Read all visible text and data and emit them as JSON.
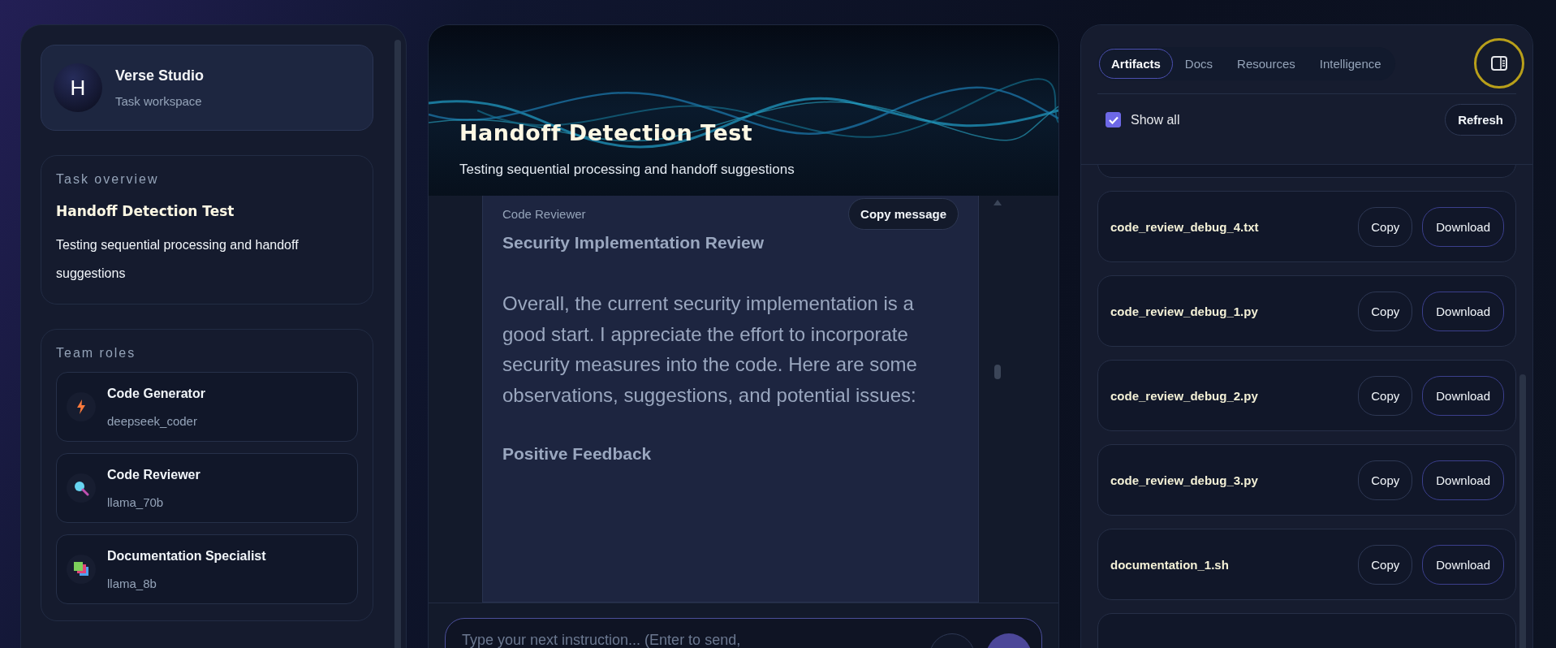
{
  "sidebar": {
    "brand": {
      "initial": "H",
      "name": "Verse Studio",
      "subtitle": "Task workspace"
    },
    "task_overview": {
      "heading": "Task overview",
      "title": "Handoff Detection Test",
      "description": "Testing sequential processing and handoff suggestions"
    },
    "team_roles": {
      "heading": "Team roles",
      "roles": [
        {
          "name": "Code Generator",
          "model": "deepseek_coder",
          "kind": "bolt"
        },
        {
          "name": "Code Reviewer",
          "model": "llama_70b",
          "kind": "search"
        },
        {
          "name": "Documentation Specialist",
          "model": "llama_8b",
          "kind": "stack"
        }
      ]
    }
  },
  "chat": {
    "title": "Handoff Detection Test",
    "subtitle": "Testing sequential processing and handoff suggestions",
    "message": {
      "author": "Code Reviewer",
      "copy_button": "Copy message",
      "blocks": [
        {
          "kind": "heading",
          "text": "Security Implementation Review"
        },
        {
          "kind": "paragraph",
          "text": "Overall, the current security implementation is a good start. I appreciate the effort to incorporate security measures into the code. Here are some observations, suggestions, and potential issues:"
        },
        {
          "kind": "heading",
          "text": "Positive Feedback"
        }
      ]
    },
    "composer": {
      "placeholder": "Type your next instruction... (Enter to send,"
    }
  },
  "panel": {
    "tabs": [
      {
        "label": "Artifacts",
        "selected": true
      },
      {
        "label": "Docs",
        "selected": false
      },
      {
        "label": "Resources",
        "selected": false
      },
      {
        "label": "Intelligence",
        "selected": false
      }
    ],
    "show_all": {
      "label": "Show all",
      "checked": true
    },
    "refresh_button": "Refresh",
    "artifacts": [
      {
        "name": "code_review_debug_4.txt",
        "copy_button": "Copy",
        "download_button": "Download"
      },
      {
        "name": "code_review_debug_1.py",
        "copy_button": "Copy",
        "download_button": "Download"
      },
      {
        "name": "code_review_debug_2.py",
        "copy_button": "Copy",
        "download_button": "Download"
      },
      {
        "name": "code_review_debug_3.py",
        "copy_button": "Copy",
        "download_button": "Download"
      },
      {
        "name": "documentation_1.sh",
        "copy_button": "Copy",
        "download_button": "Download"
      }
    ]
  }
}
